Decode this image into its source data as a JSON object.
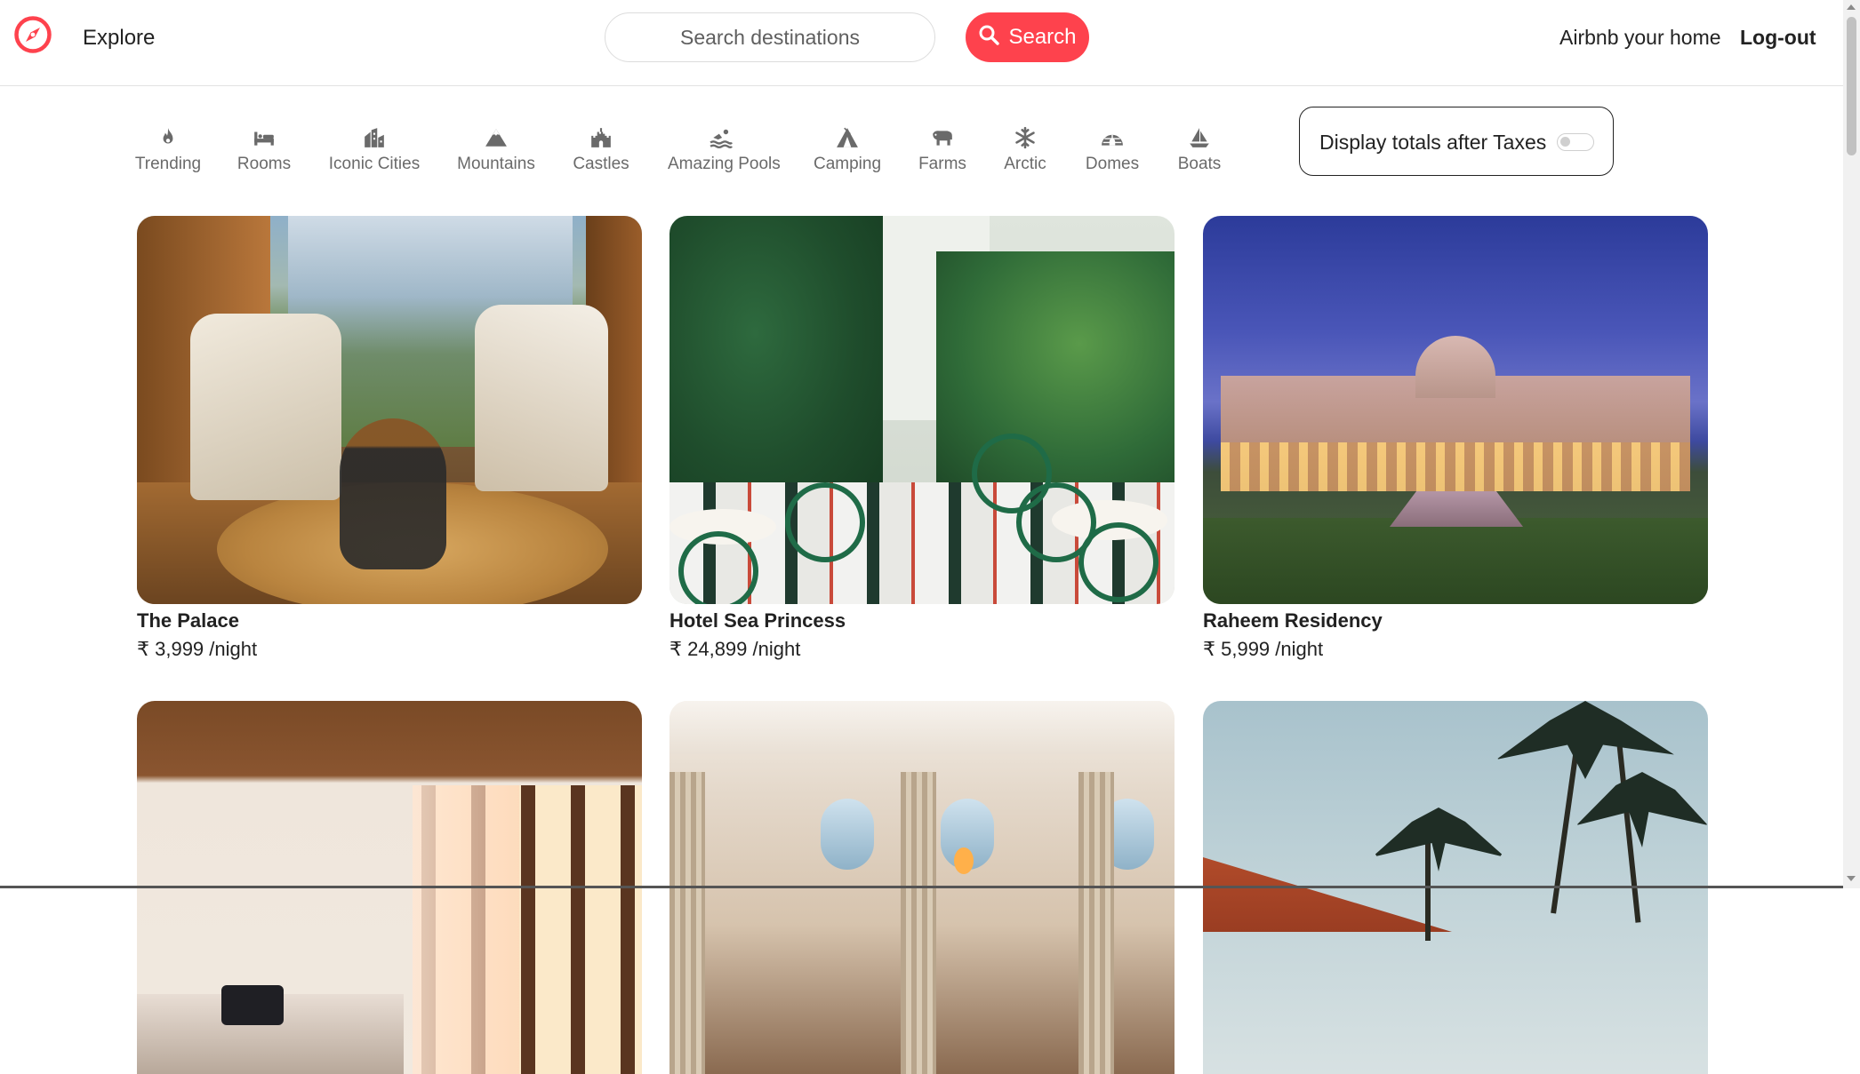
{
  "navbar": {
    "explore_label": "Explore",
    "search_placeholder": "Search destinations",
    "search_button_label": "Search",
    "host_label": "Airbnb your home",
    "logout_label": "Log-out",
    "brand_color": "#fe424d"
  },
  "filters": [
    {
      "label": "Trending",
      "icon": "fire-icon"
    },
    {
      "label": "Rooms",
      "icon": "bed-icon"
    },
    {
      "label": "Iconic Cities",
      "icon": "city-icon"
    },
    {
      "label": "Mountains",
      "icon": "mountain-icon"
    },
    {
      "label": "Castles",
      "icon": "castle-icon"
    },
    {
      "label": "Amazing Pools",
      "icon": "swimmer-icon"
    },
    {
      "label": "Camping",
      "icon": "tent-icon"
    },
    {
      "label": "Farms",
      "icon": "cow-icon"
    },
    {
      "label": "Arctic",
      "icon": "snowflake-icon"
    },
    {
      "label": "Domes",
      "icon": "igloo-icon"
    },
    {
      "label": "Boats",
      "icon": "sailboat-icon"
    }
  ],
  "tax_toggle": {
    "label": "Display totals after Taxes",
    "enabled": false
  },
  "listings": [
    {
      "title": "The Palace",
      "price": "₹ 3,999 /night"
    },
    {
      "title": "Hotel Sea Princess",
      "price": "₹ 24,899 /night"
    },
    {
      "title": "Raheem Residency",
      "price": "₹ 5,999 /night"
    },
    {
      "title": "",
      "price": ""
    },
    {
      "title": "",
      "price": ""
    },
    {
      "title": "",
      "price": ""
    }
  ]
}
